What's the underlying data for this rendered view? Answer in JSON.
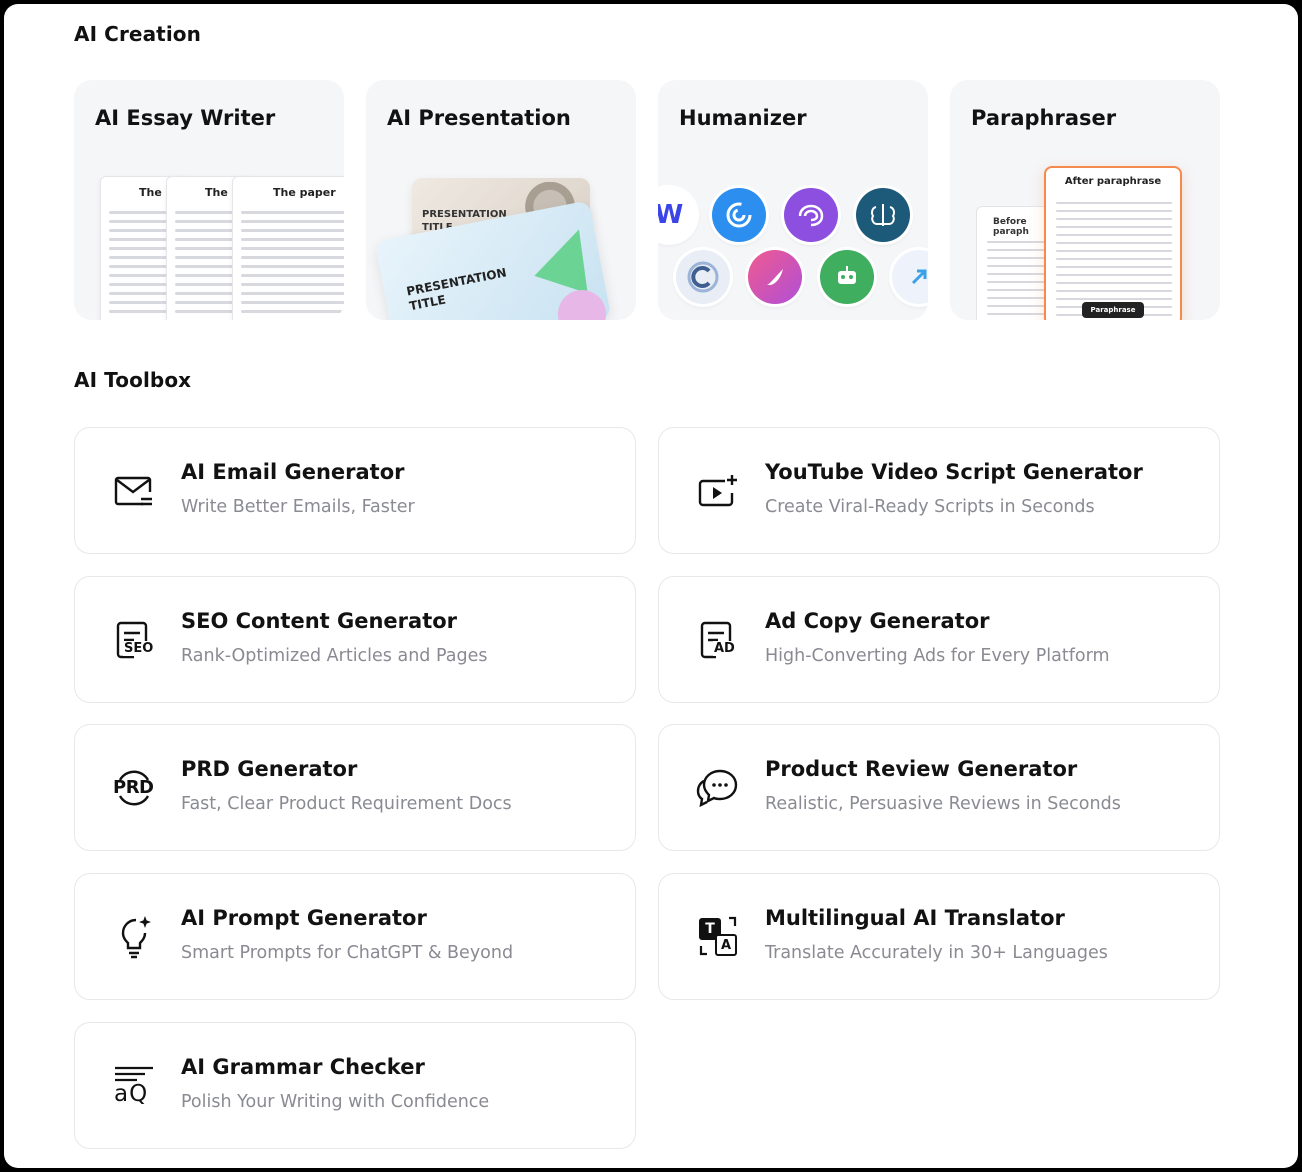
{
  "ai_creation": {
    "title": "AI Creation",
    "cards": [
      {
        "title": "AI Essay Writer",
        "paper_title": "The paper",
        "paper_title_short": "The p"
      },
      {
        "title": "AI Presentation",
        "slide_back_text": "PRESENTATION\nTITLE",
        "slide_front_text": "PRESENTATION\nTITLE"
      },
      {
        "title": "Humanizer"
      },
      {
        "title": "Paraphraser",
        "before_label": "Before paraph",
        "after_label": "After paraphrase",
        "button_label": "Paraphrase"
      }
    ]
  },
  "ai_toolbox": {
    "title": "AI Toolbox",
    "tools": [
      {
        "name": "AI Email Generator",
        "desc": "Write Better Emails, Faster",
        "icon": "email-icon"
      },
      {
        "name": "YouTube Video Script Generator",
        "desc": "Create Viral-Ready Scripts in Seconds",
        "icon": "video-script-icon"
      },
      {
        "name": "SEO Content Generator",
        "desc": "Rank-Optimized Articles and Pages",
        "icon": "seo-icon"
      },
      {
        "name": "Ad Copy Generator",
        "desc": "High-Converting Ads for Every Platform",
        "icon": "ad-icon"
      },
      {
        "name": "PRD Generator",
        "desc": "Fast, Clear Product Requirement Docs",
        "icon": "prd-icon"
      },
      {
        "name": "Product Review Generator",
        "desc": "Realistic, Persuasive Reviews in Seconds",
        "icon": "review-chat-icon"
      },
      {
        "name": "AI Prompt Generator",
        "desc": "Smart Prompts for ChatGPT & Beyond",
        "icon": "lightbulb-icon"
      },
      {
        "name": "Multilingual AI Translator",
        "desc": "Translate Accurately in 30+ Languages",
        "icon": "translate-icon"
      },
      {
        "name": "AI Grammar Checker",
        "desc": "Polish Your Writing with Confidence",
        "icon": "grammar-icon"
      }
    ]
  },
  "icon_labels": {
    "seo": "SEO",
    "ad": "AD",
    "prd": "PRD",
    "translate_t": "T",
    "translate_a": "A",
    "grammar": "aQ",
    "humanizer_w": "W"
  },
  "colors": {
    "accent_orange": "#f5894e",
    "card_bg": "#f5f6f8",
    "desc_gray": "#8a8b92"
  }
}
